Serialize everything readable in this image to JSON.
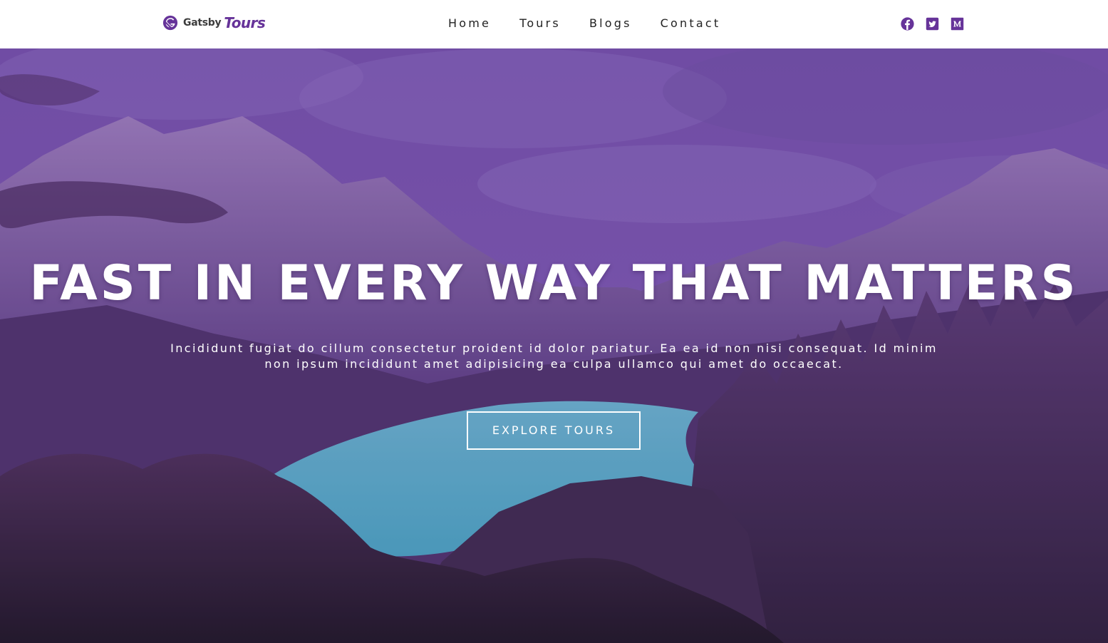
{
  "header": {
    "logo": {
      "brand": "Gatsby",
      "accent": "Tours"
    },
    "nav": [
      {
        "label": "Home"
      },
      {
        "label": "Tours"
      },
      {
        "label": "Blogs"
      },
      {
        "label": "Contact"
      }
    ],
    "social": [
      {
        "icon": "facebook-icon"
      },
      {
        "icon": "twitter-icon"
      },
      {
        "icon": "medium-icon"
      }
    ]
  },
  "hero": {
    "title": "FAST IN EVERY WAY THAT MATTERS",
    "text": "Incididunt fugiat do cillum consectetur proident id dolor pariatur. Ea ea id non nisi consequat. Id minim non ipsum incididunt amet adipisicing ea culpa ullamco qui amet do occaecat.",
    "button": "EXPLORE TOURS"
  },
  "colors": {
    "brand": "#663399",
    "nav_text": "#222222",
    "hero_text": "#ffffff"
  }
}
